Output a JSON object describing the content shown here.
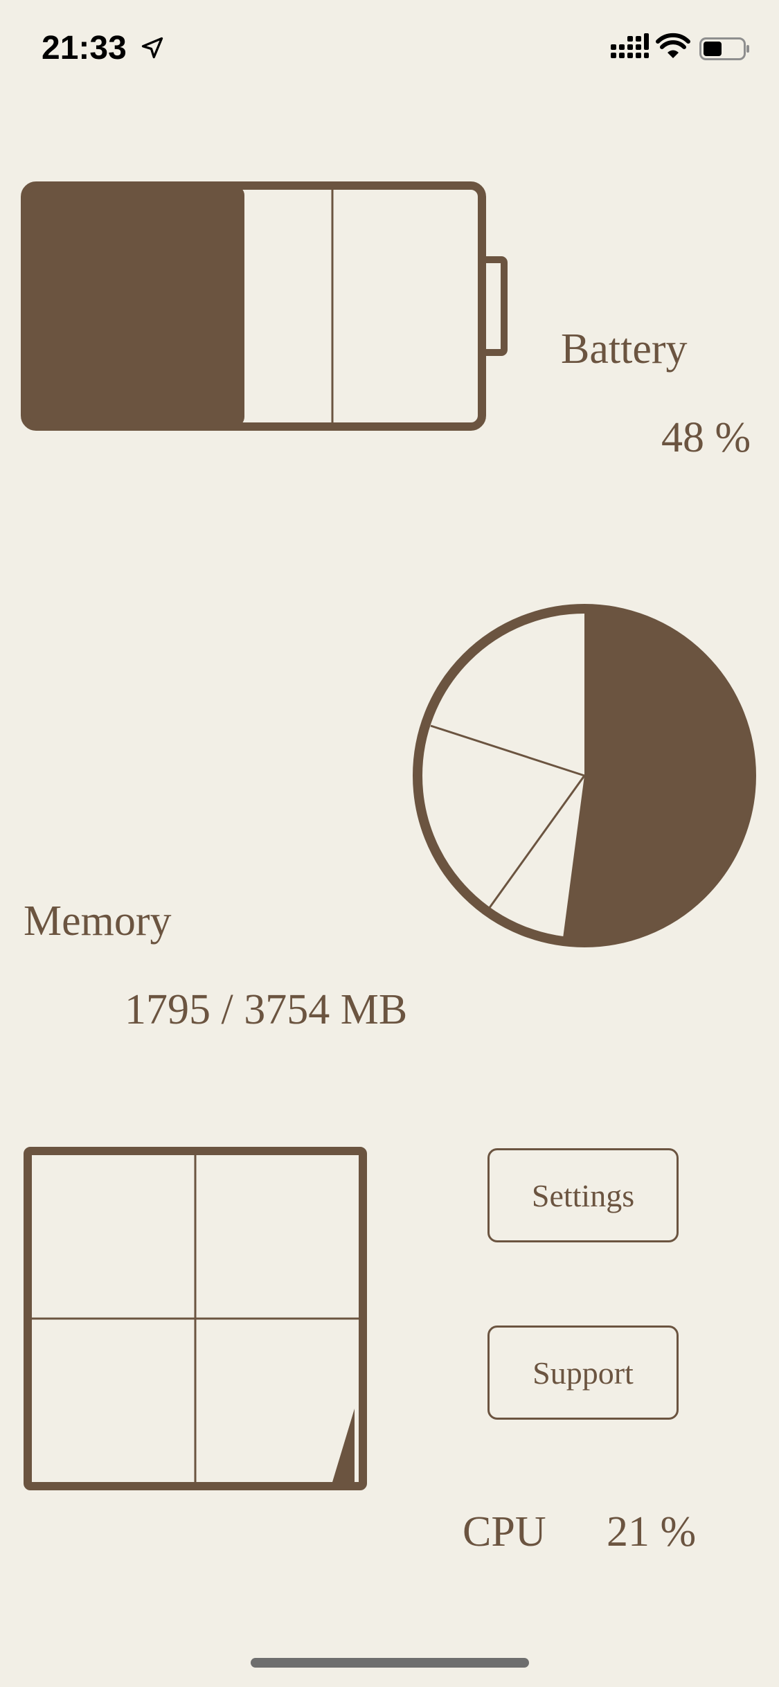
{
  "status_bar": {
    "time": "21:33",
    "icons": [
      "location-arrow-icon",
      "cellular-signal-icon",
      "wifi-icon",
      "battery-icon"
    ]
  },
  "colors": {
    "background": "#F2EFE6",
    "accent": "#6B5440"
  },
  "battery": {
    "label": "Battery",
    "value_text": "48 %",
    "level": 0.48
  },
  "memory": {
    "label": "Memory",
    "value_text": "1795 / 3754 MB",
    "used_fraction": 0.478
  },
  "cpu": {
    "label": "CPU",
    "value_text": "21 %"
  },
  "buttons": {
    "settings": "Settings",
    "support": "Support"
  }
}
